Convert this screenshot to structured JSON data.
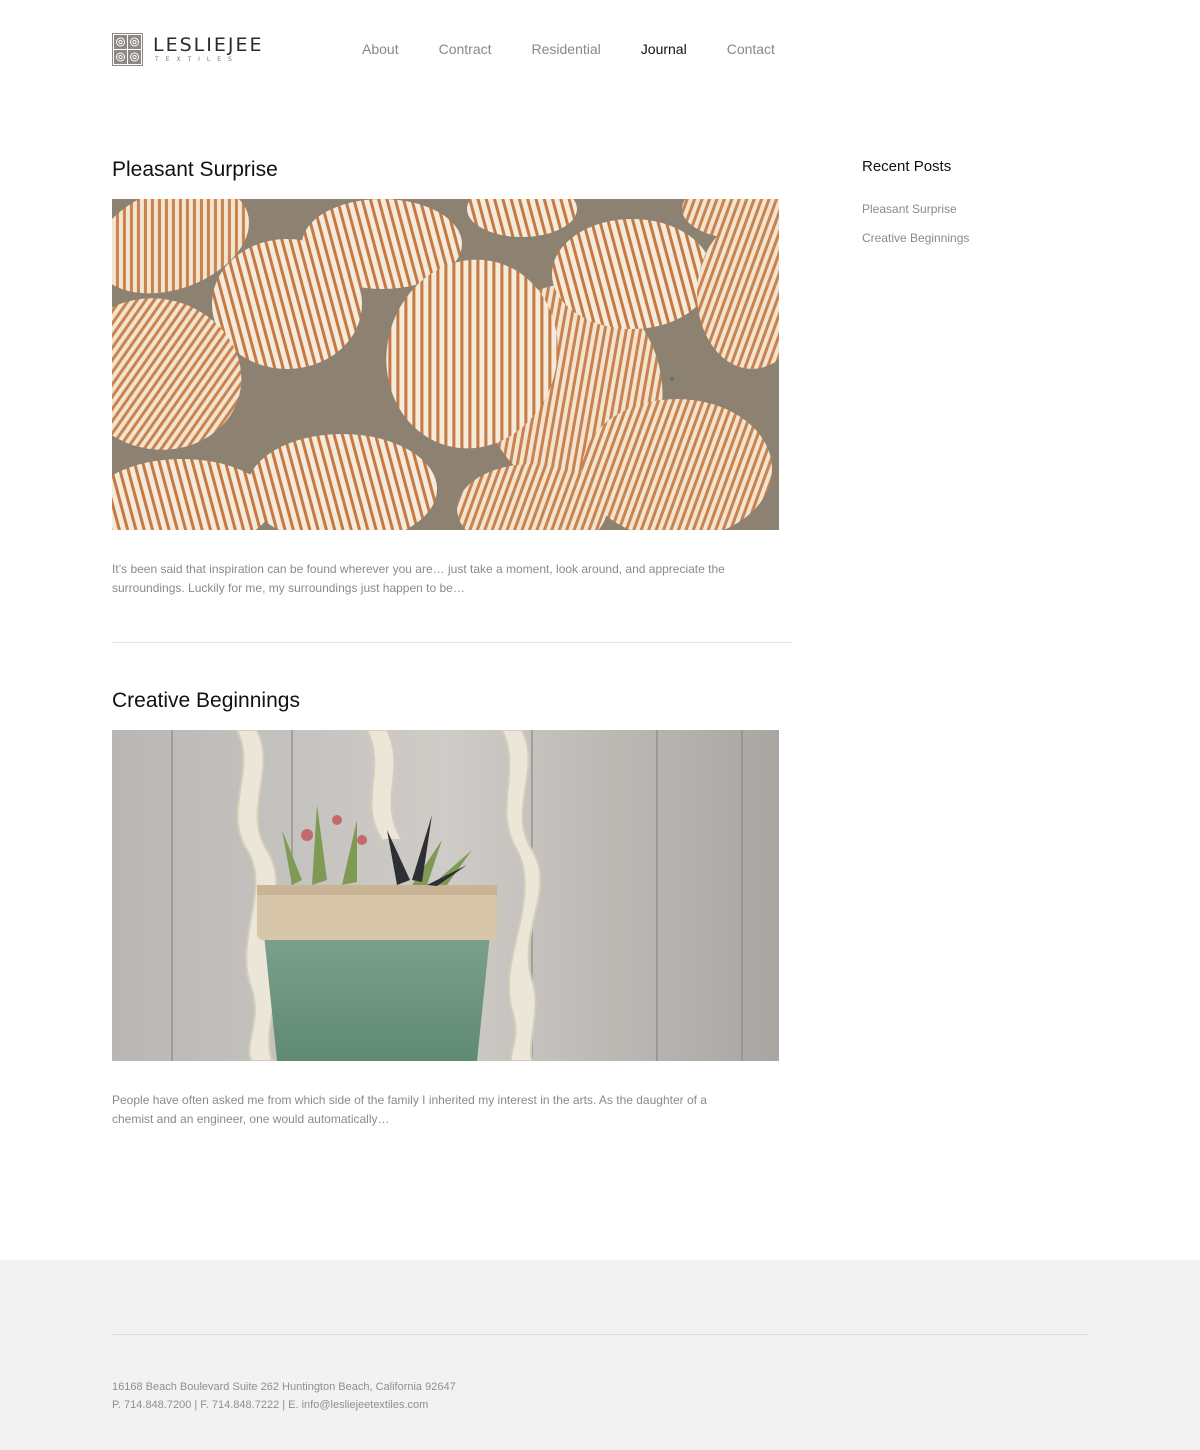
{
  "header": {
    "logo": {
      "name": "LESLIEJEE",
      "sub": "TEXTILES"
    },
    "nav": [
      {
        "label": "About",
        "active": false
      },
      {
        "label": "Contract",
        "active": false
      },
      {
        "label": "Residential",
        "active": false
      },
      {
        "label": "Journal",
        "active": true
      },
      {
        "label": "Contact",
        "active": false
      }
    ]
  },
  "posts": [
    {
      "title": "Pleasant Surprise",
      "image": "seashells-photo",
      "excerpt_line1": "It’s been said that inspiration can be found wherever you are… just take a moment, look around, and appreciate the",
      "excerpt_line2": "surroundings. Luckily for me, my surroundings just happen to be…"
    },
    {
      "title": "Creative Beginnings",
      "image": "macrame-plant-hanger-photo",
      "excerpt_line1": "People have often asked me from which side of the family I inherited my interest in the arts. As the daughter of a",
      "excerpt_line2": "chemist and an engineer, one would automatically…"
    }
  ],
  "sidebar": {
    "title": "Recent Posts",
    "items": [
      {
        "label": "Pleasant Surprise"
      },
      {
        "label": "Creative Beginnings"
      }
    ]
  },
  "footer": {
    "address": "16168 Beach Boulevard Suite 262 Huntington Beach, California 92647",
    "contact": "P. 714.848.7200 | F. 714.848.7222 | E. info@lesliejeetextiles.com"
  },
  "colors": {
    "text": "#111111",
    "muted": "#888888",
    "footer_bg": "#f2f2f2",
    "logo_mark": "#8e8984"
  }
}
